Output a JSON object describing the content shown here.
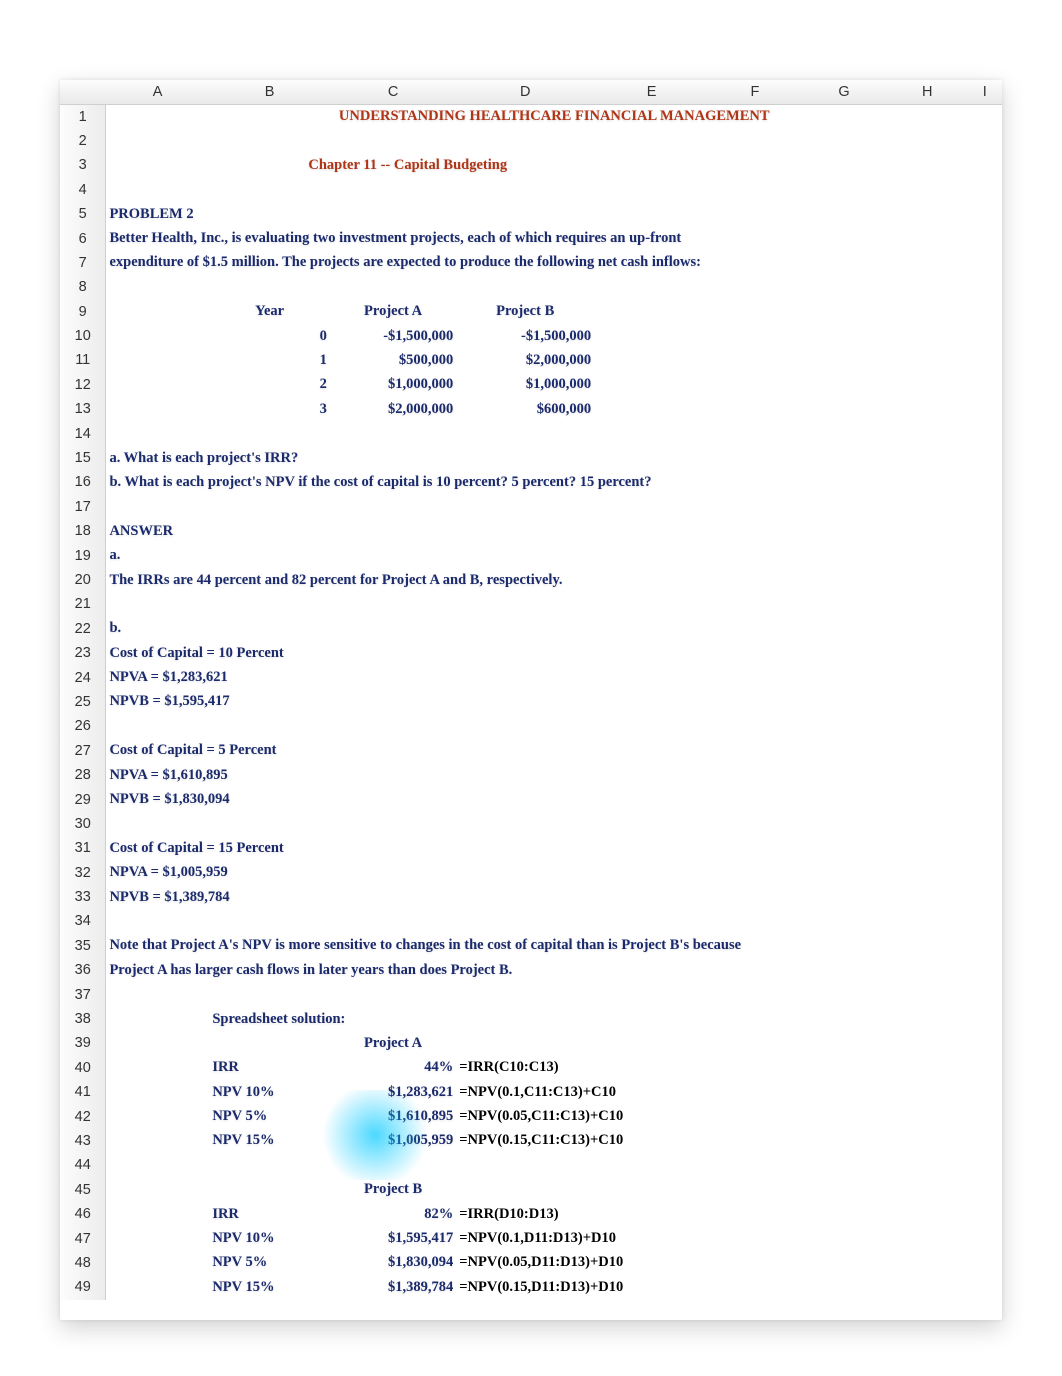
{
  "columns": [
    "A",
    "B",
    "C",
    "D",
    "E",
    "F",
    "G",
    "H",
    "I"
  ],
  "header": {
    "title": "UNDERSTANDING HEALTHCARE FINANCIAL MANAGEMENT",
    "chapter": "Chapter 11 -- Capital Budgeting"
  },
  "problem": {
    "label": "PROBLEM 2",
    "line1": "Better Health, Inc., is evaluating two investment projects, each of which requires an up-front",
    "line2": "expenditure of $1.5 million. The projects are expected to produce the following net cash inflows:"
  },
  "tableHeaders": {
    "year": "Year",
    "a": "Project A",
    "b": "Project B"
  },
  "cashflows": [
    {
      "year": "0",
      "a": "-$1,500,000",
      "b": "-$1,500,000"
    },
    {
      "year": "1",
      "a": "$500,000",
      "b": "$2,000,000"
    },
    {
      "year": "2",
      "a": "$1,000,000",
      "b": "$1,000,000"
    },
    {
      "year": "3",
      "a": "$2,000,000",
      "b": "$600,000"
    }
  ],
  "questions": {
    "a": "a. What is each project's IRR?",
    "b": "b. What is each project's NPV if the cost of capital is 10 percent? 5 percent? 15 percent?"
  },
  "answer": {
    "label": "ANSWER",
    "a_label": "a.",
    "a_text": "The IRRs are 44 percent and 82 percent for Project A and B, respectively.",
    "b_label": "b.",
    "coc10": "Cost of Capital = 10 Percent",
    "npva10": "NPVA = $1,283,621",
    "npvb10": "NPVB = $1,595,417",
    "coc5": "Cost of Capital = 5 Percent",
    "npva5": "NPVA = $1,610,895",
    "npvb5": "NPVB = $1,830,094",
    "coc15": "Cost of Capital = 15 Percent",
    "npva15": "NPVA = $1,005,959",
    "npvb15": "NPVB = $1,389,784",
    "note1": "Note that Project A's NPV is more sensitive to changes in the cost of capital than is Project B's because",
    "note2": "Project A has larger cash flows in later years than does Project B."
  },
  "solution": {
    "label": "Spreadsheet solution:",
    "projA": "Project A",
    "projB": "Project B",
    "labels": {
      "irr": "IRR",
      "npv10": "NPV 10%",
      "npv5": "NPV 5%",
      "npv15": "NPV 15%"
    },
    "a": {
      "irr": {
        "val": "44%",
        "formula": "=IRR(C10:C13)"
      },
      "npv10": {
        "val": "$1,283,621",
        "formula": "=NPV(0.1,C11:C13)+C10"
      },
      "npv5": {
        "val": "$1,610,895",
        "formula": "=NPV(0.05,C11:C13)+C10"
      },
      "npv15": {
        "val": "$1,005,959",
        "formula": "=NPV(0.15,C11:C13)+C10"
      }
    },
    "b": {
      "irr": {
        "val": "82%",
        "formula": "=IRR(D10:D13)"
      },
      "npv10": {
        "val": "$1,595,417",
        "formula": "=NPV(0.1,D11:D13)+D10"
      },
      "npv5": {
        "val": "$1,830,094",
        "formula": "=NPV(0.05,D11:D13)+D10"
      },
      "npv15": {
        "val": "$1,389,784",
        "formula": "=NPV(0.15,D11:D13)+D10"
      }
    }
  },
  "chart_data": {
    "type": "table",
    "title": "Net cash inflows by Year",
    "columns": [
      "Year",
      "Project A",
      "Project B"
    ],
    "rows": [
      [
        0,
        -1500000,
        -1500000
      ],
      [
        1,
        500000,
        2000000
      ],
      [
        2,
        1000000,
        1000000
      ],
      [
        3,
        2000000,
        600000
      ]
    ],
    "computed": {
      "IRR": {
        "Project A": 0.44,
        "Project B": 0.82
      },
      "NPV_10pct": {
        "Project A": 1283621,
        "Project B": 1595417
      },
      "NPV_5pct": {
        "Project A": 1610895,
        "Project B": 1830094
      },
      "NPV_15pct": {
        "Project A": 1005959,
        "Project B": 1389784
      }
    }
  }
}
